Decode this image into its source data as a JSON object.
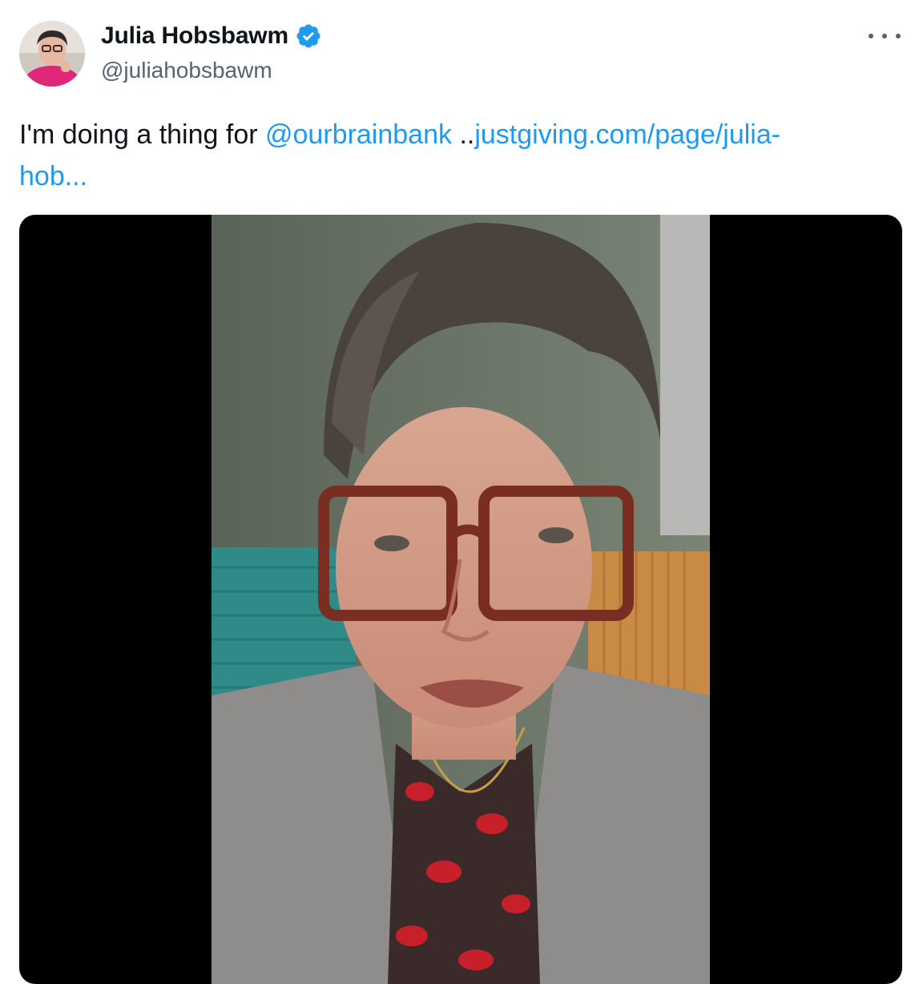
{
  "author": {
    "display_name": "Julia Hobsbawm",
    "handle": "@juliahobsbawm",
    "verified": true,
    "avatar_icon": "profile-photo"
  },
  "more_icon": "ellipsis-icon",
  "tweet": {
    "text_before": "I'm doing a thing for ",
    "mention": "@ourbrainbank",
    "separator": " ..",
    "link_line1": "justgiving.com/page/julia-",
    "link_line2": "hob..."
  },
  "colors": {
    "link": "#1d9bf0",
    "verified_badge": "#1d9bf0",
    "text": "#0f1419",
    "secondary": "#536471",
    "media_background": "#000000"
  },
  "media": {
    "type": "video",
    "icon": "video-thumbnail"
  }
}
